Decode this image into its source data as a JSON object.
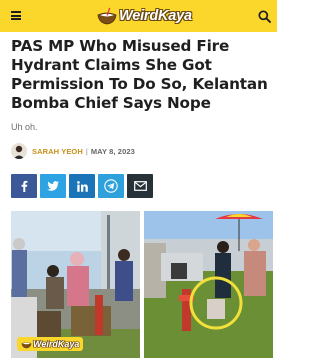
{
  "header": {
    "logo_text": "WeirdKaya",
    "menu_icon": "hamburger-menu-icon",
    "search_icon": "search-icon",
    "background_color": "#fbd72c"
  },
  "article": {
    "headline": "PAS MP Who Misused Fire Hydrant Claims She Got Permission To Do So, Kelantan Bomba Chief Says Nope",
    "subtitle": "Uh oh.",
    "author": "SARAH YEOH",
    "separator": "|",
    "date": "MAY 8, 2023",
    "author_color": "#c7901b"
  },
  "share": {
    "buttons": [
      {
        "name": "facebook",
        "icon": "facebook-icon",
        "color": "#3b5998"
      },
      {
        "name": "twitter",
        "icon": "twitter-icon",
        "color": "#2da3e3"
      },
      {
        "name": "linkedin",
        "icon": "linkedin-icon",
        "color": "#1b74b7"
      },
      {
        "name": "telegram",
        "icon": "telegram-icon",
        "color": "#2ea0dc"
      },
      {
        "name": "email",
        "icon": "mail-icon",
        "color": "#263238"
      }
    ]
  },
  "hero": {
    "watermark_text": "WeirdKaya"
  }
}
